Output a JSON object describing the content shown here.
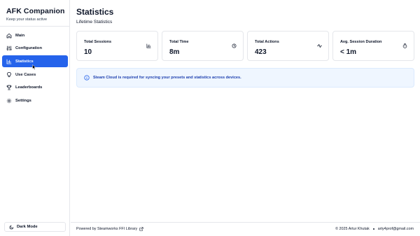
{
  "app": {
    "title": "AFK Companion",
    "subtitle": "Keep your status active"
  },
  "sidebar": {
    "items": [
      {
        "label": "Main",
        "icon": "home-icon",
        "active": false
      },
      {
        "label": "Configuration",
        "icon": "sliders-icon",
        "active": false
      },
      {
        "label": "Statistics",
        "icon": "bar-chart-icon",
        "active": true
      },
      {
        "label": "Use Cases",
        "icon": "lightbulb-icon",
        "active": false
      },
      {
        "label": "Leaderboards",
        "icon": "trophy-icon",
        "active": false
      },
      {
        "label": "Settings",
        "icon": "gear-icon",
        "active": false
      }
    ],
    "dark_mode_label": "Dark Mode"
  },
  "main": {
    "title": "Statistics",
    "subtitle": "Lifetime Statistics",
    "cards": [
      {
        "label": "Total Sessions",
        "value": "10",
        "icon": "bar-chart-icon"
      },
      {
        "label": "Total Time",
        "value": "8m",
        "icon": "clock-icon"
      },
      {
        "label": "Total Actions",
        "value": "423",
        "icon": "activity-icon"
      },
      {
        "label": "Avg. Session Duration",
        "value": "< 1m",
        "icon": "timer-icon"
      }
    ],
    "info": {
      "icon": "info-icon",
      "text": "Steam Cloud is required for syncing your presets and statistics across devices."
    }
  },
  "footer": {
    "powered_by": "Powered by Steamworks FFI Library",
    "copyright": "© 2025 Artur Khutak",
    "email": "arty4prof@gmail.com"
  },
  "colors": {
    "accent": "#2563eb",
    "info_bg": "#eff6ff",
    "info_text": "#1e40af",
    "border": "#e5e7eb"
  }
}
